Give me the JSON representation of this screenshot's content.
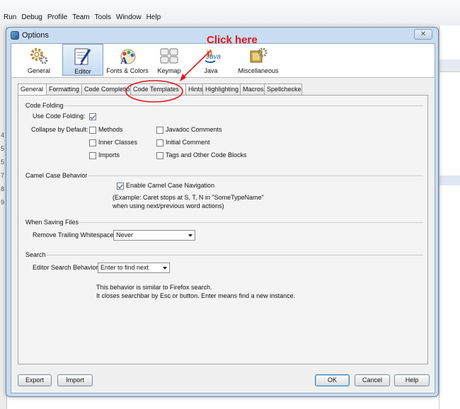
{
  "ide": {
    "menu": [
      "Run",
      "Debug",
      "Profile",
      "Team",
      "Tools",
      "Window",
      "Help"
    ],
    "line_numbers": [
      "4",
      "5",
      "5",
      "7",
      "8",
      "9"
    ]
  },
  "dialog": {
    "title": "Options",
    "close_glyph": "✕"
  },
  "categories": [
    {
      "label": "General",
      "icon": "general-gear-icon"
    },
    {
      "label": "Editor",
      "icon": "editor-icon"
    },
    {
      "label": "Fonts & Colors",
      "icon": "fonts-colors-icon"
    },
    {
      "label": "Keymap",
      "icon": "keymap-icon"
    },
    {
      "label": "Java",
      "icon": "java-icon"
    },
    {
      "label": "Miscellaneous",
      "icon": "miscellaneous-icon"
    }
  ],
  "java_logo_text": "Java",
  "tabs": [
    "General",
    "Formatting",
    "Code Completion",
    "Code Templates",
    "Hints",
    "Highlighting",
    "Macros",
    "Spellchecker"
  ],
  "code_folding": {
    "header": "Code Folding",
    "use_label": "Use Code Folding:",
    "collapse_label": "Collapse by Default:",
    "options": {
      "methods": "Methods",
      "inner_classes": "Inner Classes",
      "imports": "Imports",
      "javadoc": "Javadoc Comments",
      "initial_comment": "Initial Comment",
      "tags": "Tags and Other Code Blocks"
    }
  },
  "camel_case": {
    "header": "Camel Case  Behavior",
    "enable_label": "Enable Camel Case Navigation",
    "example_line1": "(Example: Caret stops at S, T, N in \"SomeTypeName\"",
    "example_line2": "when using next/previous word actions)"
  },
  "saving": {
    "header": "When Saving Files",
    "trailing_label": "Remove Trailing Whitespace",
    "trailing_value": "Never"
  },
  "search": {
    "header": "Search",
    "behavior_label": "Editor Search Behavior",
    "behavior_value": "Enter to find next",
    "desc_line1": "This behavior is similar to Firefox search.",
    "desc_line2": "It closes searchbar by Esc or button. Enter means find a new instance."
  },
  "buttons": {
    "export": "Export",
    "import": "Import",
    "ok": "OK",
    "cancel": "Cancel",
    "help": "Help"
  },
  "annotation": {
    "text": "Click here",
    "color": "#e0181e"
  }
}
